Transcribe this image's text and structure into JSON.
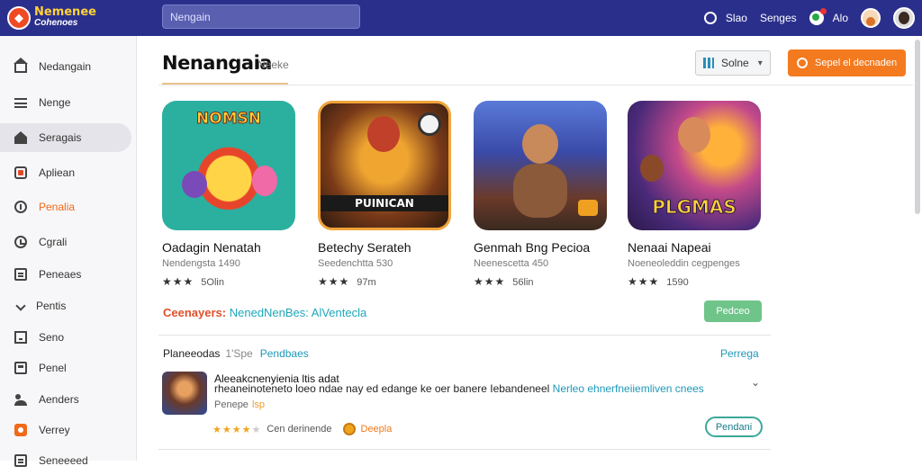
{
  "app": {
    "logo_line1": "Nemenee",
    "logo_line2": "Cohenoes"
  },
  "search": {
    "value": "Nengain"
  },
  "topbar": {
    "item1_label": "Slao",
    "item2_label": "Senges",
    "item3_label": "Alo"
  },
  "sidebar": {
    "items": [
      {
        "label": "Nedangain",
        "icon": "home-icon"
      },
      {
        "label": "Nenge",
        "icon": "menu-icon"
      },
      {
        "label": "Seragais",
        "icon": "house-icon"
      },
      {
        "label": "Apliean",
        "icon": "app-icon"
      },
      {
        "label": "Penalia",
        "icon": "info-icon"
      },
      {
        "label": "Cgrali",
        "icon": "clock-icon"
      },
      {
        "label": "Peneaes",
        "icon": "doc-icon"
      },
      {
        "label": "Pentis",
        "icon": "pen-icon"
      },
      {
        "label": "Seno",
        "icon": "square-icon"
      },
      {
        "label": "Penel",
        "icon": "box-icon"
      },
      {
        "label": "Aenders",
        "icon": "users-icon"
      },
      {
        "label": "Verrey",
        "icon": "orange-app-icon"
      },
      {
        "label": "Seneeeed",
        "icon": "doc-icon"
      }
    ]
  },
  "main": {
    "title": "Nenangaia",
    "subtitle": "Neeke",
    "sort_label": "Solne",
    "cta_label": "Sepel el decnaden"
  },
  "cards": [
    {
      "title": "Oadagin Nenatah",
      "sub": "Nendengsta 1490",
      "stars": "★★★",
      "rating": "5Olin",
      "art_text": "NOMSN"
    },
    {
      "title": "Betechy Serateh",
      "sub": "Seedenchtta 530",
      "stars": "★★★",
      "rating": "97m",
      "art_text": "PUINICAN"
    },
    {
      "title": "Genmah Bng Pecioa",
      "sub": "Neenescetta 450",
      "stars": "★★★",
      "rating": "56lin",
      "art_text": ""
    },
    {
      "title": "Nenaai Napeai",
      "sub": "Noeneoleddin cegpenges",
      "stars": "★★★",
      "rating": "1590",
      "art_text": "PLGMAS"
    }
  ],
  "promo": {
    "label_a": "Ceenayers:",
    "label_b": "NenedNenBes: AlVentecla",
    "button": "Pedceo"
  },
  "section": {
    "title": "Planeeodas",
    "count": "1'Spe",
    "link_inline": "Pendbaes",
    "link_right": "Perrega"
  },
  "list_item": {
    "title": "Aleeakcnenyienia ltis adat",
    "desc_prefix": "rheaneinoteneto loeo ndae nay ed edange ke oer banere Iebandeneel",
    "desc_highlight": "Nerleo ehnerfneiiemliven",
    "desc_suffix": "cnees",
    "tag_label": "Penepe",
    "tag_value": "lsp",
    "stars": "★★★★",
    "star_half": "★",
    "meta_label": "Cen derinende",
    "meta_orange": "Deepla",
    "button": "Pendani"
  }
}
